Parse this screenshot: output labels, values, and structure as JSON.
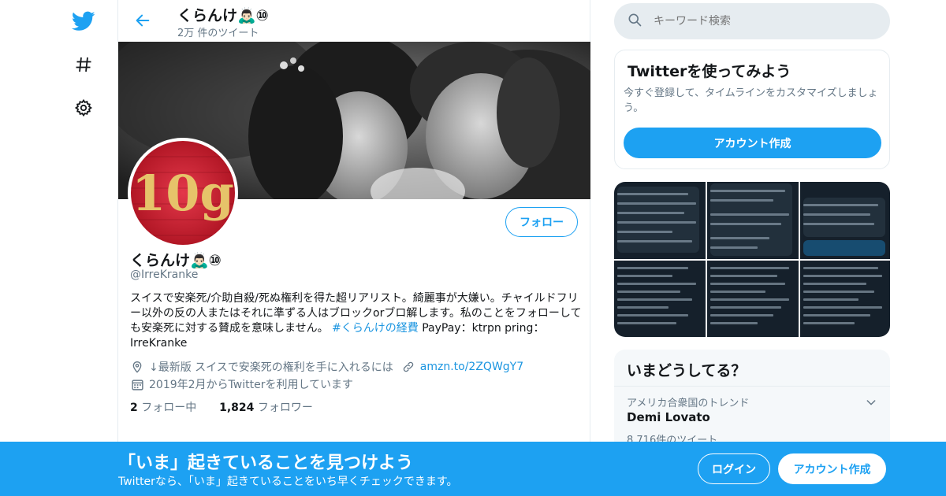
{
  "colors": {
    "accent": "#1da1f2",
    "link": "#1b95e0",
    "secondary_text": "#657786",
    "border": "#e6ecf0"
  },
  "nav": {
    "icons": [
      "twitter-bird-icon",
      "hashtag-icon",
      "gear-icon"
    ]
  },
  "header": {
    "name": "くらんけ🙇🏻‍♂️⑩",
    "tweet_count": "2万 件のツイート"
  },
  "profile": {
    "name": "くらんけ🙇🏻‍♂️⑩",
    "handle": "@IrreKranke",
    "follow_label": "フォロー",
    "avatar_text": "10g",
    "bio_pre": "スイスで安楽死/介助自殺/死ぬ権利を得た超リアリスト。綺麗事が大嫌い。チャイルドフリー以外の反の人またはそれに準ずる人はブロックorブロ解します。私のことをフォローしても安楽死に対する賛成を意味しません。",
    "bio_hashtag": "#くらんけの経費",
    "bio_post": " PayPay：ktrpn pring：IrreKranke",
    "location": "↓最新版 スイスで安楽死の権利を手に入れるには",
    "url": "amzn.to/2ZQWgY7",
    "joined": "2019年2月からTwitterを利用しています",
    "following_count": "2",
    "following_label": "フォロー中",
    "followers_count": "1,824",
    "followers_label": "フォロワー"
  },
  "search": {
    "placeholder": "キーワード検索"
  },
  "signup_card": {
    "title": "Twitterを使ってみよう",
    "description": "今すぐ登録して、タイムラインをカスタマイズしましょう。",
    "button": "アカウント作成"
  },
  "trends": {
    "title": "いまどうしてる？",
    "items": [
      {
        "context": "アメリカ合衆国のトレンド",
        "name": "Demi Lovato",
        "count": "8,716件のツイート"
      }
    ]
  },
  "bottom_bar": {
    "title": "「いま」起きていることを見つけよう",
    "subtitle": "Twitterなら、「いま」起きていることをいち早くチェックできます。",
    "login": "ログイン",
    "signup": "アカウント作成"
  }
}
